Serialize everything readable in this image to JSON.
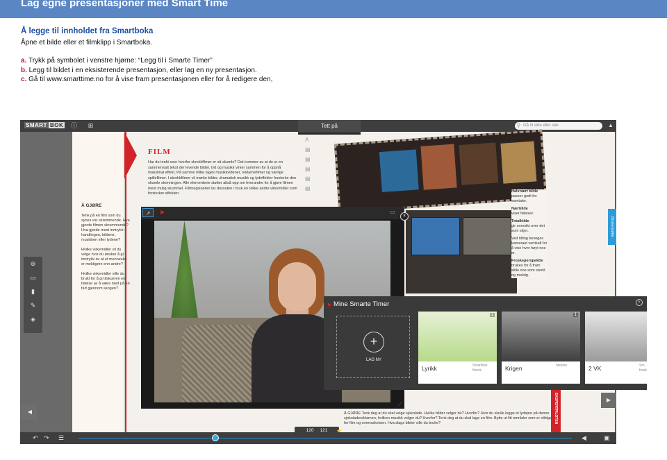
{
  "banner": {
    "title": "Lag egne presentasjoner med Smart Time"
  },
  "instructions": {
    "heading": "Å legge til innholdet fra Smartboka",
    "intro": "Åpne et bilde eller et filmklipp i Smartboka.",
    "steps": [
      {
        "letter": "a.",
        "text": "Trykk på symbolet i venstre hjørne: “Legg til i Smarte Timer”"
      },
      {
        "letter": "b.",
        "text": "Legg til bildet i en eksisterende presentasjon, eller lag en ny presentasjon."
      },
      {
        "letter": "c.",
        "text": "Gå til www.smarttime.no for å vise fram presentasjonen eller for å redigere den,"
      }
    ]
  },
  "app": {
    "logo_part1": "SMART",
    "logo_part2": "BOK",
    "top_tab": "Tett på",
    "search_placeholder": "Gå til side eller søk",
    "side_tab": "Brukerstøtte",
    "book": {
      "chapter_title": "FILM",
      "intro_text": "Har du tenkt over hvorfor skrekkfilmer er så skumle? Det kommer av at de er en sammensatt tekst der levende bilder, lyd og musikk virker sammen for å oppnå maksimal effekt. På samme måte lages musikkvideoer, reklamefilmer og vanlige spillefilmer. I skrekkfilmer vil mørke bilder, dramatisk musikk og lydeffekter forsterke den skumle stemningen. Alle elementene støtter altså opp om hverandre for å gjøre filmen mest mulig skummel. Filmregissøren tar dessuten i bruk en rekke andre virkemidler som forsterker effekten.",
      "agjore_title": "Å GJØRE",
      "agjore_items": [
        "Tenk på en film som du synes var skremmende. Hva gjorde filmen skremmende? Hva gjorde mest inntrykk: handlingen, bildene, musikken eller lydene?",
        "Hvilke virkemidler vil du velge hvis du ønsker å gi inntrykk av at et menneske er mektigere enn andre?",
        "Hvilke virkemidler ville du brukt for å gi tilskueren en følelse av å være med på en fart gjennom skogen?"
      ],
      "notes": [
        {
          "title": "Halvnært bilde",
          "text": "passer godt for samtaler."
        },
        {
          "title": "Nærbilde",
          "text": "viser følelser."
        },
        {
          "title": "Totalbilde",
          "text": "gir oversikt over det som skjer."
        },
        {
          "title": "",
          "text": "Ved tilting beveges kameraet vertikalt for å vise hvor høyt noe er."
        },
        {
          "title": "Froskeperspektiv",
          "text": "brukes for å fram stille noe som sterkt og mektig."
        }
      ],
      "bottom_task": "Å GJØRE  Tenk deg at du skal velge sjokolade. Hvilke bilder velger du? Hvorfor?  Hvis du skulle legge et lydspor på denne sjokolade­reklamen, hvilken musikk velger du? Hvorfor?  Tenk deg at du skal lage en film. Bytte ut litt områder som er viktige for film og overraskelsen. Hva slags bilder ville du bruke?",
      "expert_tab": "EKSPERTPILOTEN"
    },
    "page_left": "120",
    "page_right": "121"
  },
  "smarte_timer": {
    "title": "Mine Smarte Timer",
    "new_label": "LAG NY",
    "cards": [
      {
        "title": "Lyrikk",
        "subject": "Smartbok Norsk",
        "count": "1"
      },
      {
        "title": "Krigen",
        "subject": "historie",
        "count": "1"
      },
      {
        "title": "2 VK",
        "subject": "Sm. forsk",
        "count": ""
      }
    ]
  },
  "colors": {
    "accent_red": "#d2232a",
    "banner_blue": "#5b86c4",
    "heading_blue": "#1f4fa3",
    "slider_blue": "#1f8fd1"
  }
}
